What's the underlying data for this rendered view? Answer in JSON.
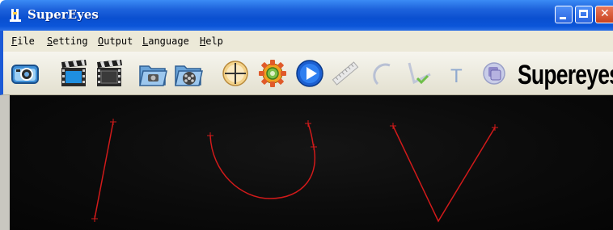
{
  "window": {
    "title": "SuperEyes",
    "controls": [
      "minimize",
      "maximize",
      "close"
    ]
  },
  "menu": {
    "items": [
      "File",
      "Setting",
      "Output",
      "Language",
      "Help"
    ]
  },
  "toolbar": {
    "tools": [
      {
        "name": "snapshot-camera",
        "icon": "camera-icon"
      },
      {
        "name": "record-video",
        "icon": "film-clapper-icon"
      },
      {
        "name": "video-settings",
        "icon": "film-clapper-dark-icon"
      },
      {
        "name": "open-photo-folder",
        "icon": "photo-folder-icon"
      },
      {
        "name": "open-video-folder",
        "icon": "video-folder-icon"
      },
      {
        "name": "crosshair",
        "icon": "crosshair-icon"
      },
      {
        "name": "settings",
        "icon": "gear-icon"
      },
      {
        "name": "play",
        "icon": "play-icon"
      },
      {
        "name": "measure-line",
        "icon": "ruler-icon"
      },
      {
        "name": "measure-arc",
        "icon": "arc-icon"
      },
      {
        "name": "measure-angle",
        "icon": "angle-icon"
      },
      {
        "name": "add-text",
        "icon": "text-icon"
      },
      {
        "name": "overlay",
        "icon": "overlay-icon"
      }
    ],
    "brand": "Supereyes"
  },
  "canvas": {
    "background": "#0b0b0b",
    "stroke_color": "#d11a1a",
    "shapes": [
      "line",
      "arc",
      "angle"
    ]
  },
  "colors": {
    "titlebar": "#0b55d8",
    "menubar": "#ece9d8",
    "close": "#d5502c"
  }
}
